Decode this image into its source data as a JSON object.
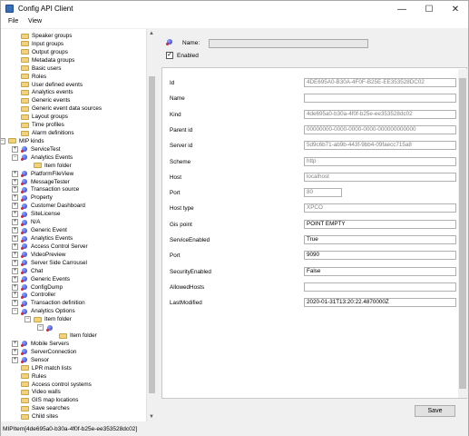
{
  "window": {
    "title": "Config API Client",
    "minimize": "—",
    "maximize": "☐",
    "close": "✕"
  },
  "menu": {
    "file": "File",
    "view": "View"
  },
  "tree": [
    {
      "label": "Speaker groups",
      "icon": "folder"
    },
    {
      "label": "Input groups",
      "icon": "folder"
    },
    {
      "label": "Output groups",
      "icon": "folder"
    },
    {
      "label": "Metadata groups",
      "icon": "folder"
    },
    {
      "label": "Basic users",
      "icon": "folder"
    },
    {
      "label": "Roles",
      "icon": "folder"
    },
    {
      "label": "User defined events",
      "icon": "folder"
    },
    {
      "label": "Analytics events",
      "icon": "folder"
    },
    {
      "label": "Generic events",
      "icon": "folder"
    },
    {
      "label": "Generic event data sources",
      "icon": "folder"
    },
    {
      "label": "Layout groups",
      "icon": "folder"
    },
    {
      "label": "Time profiles",
      "icon": "folder"
    },
    {
      "label": "Alarm definitions",
      "icon": "folder"
    },
    {
      "label": "MIP kinds",
      "icon": "folder",
      "expander": "−"
    },
    {
      "label": "ServiceTest",
      "icon": "pin",
      "expander": "+"
    },
    {
      "label": "Analytics Events",
      "icon": "pin",
      "expander": "−"
    },
    {
      "label": "Item folder",
      "icon": "folder"
    },
    {
      "label": "PlatformFileView",
      "icon": "pin",
      "expander": "+"
    },
    {
      "label": "MessageTester",
      "icon": "pin",
      "expander": "+"
    },
    {
      "label": "Transaction source",
      "icon": "pin",
      "expander": "+"
    },
    {
      "label": "Property",
      "icon": "pin",
      "expander": "+"
    },
    {
      "label": "Customer Dashboard",
      "icon": "pin",
      "expander": "+"
    },
    {
      "label": "SiteLicense",
      "icon": "pin",
      "expander": "+"
    },
    {
      "label": "N/A",
      "icon": "pin",
      "expander": "+"
    },
    {
      "label": "Generic Event",
      "icon": "pin",
      "expander": "+"
    },
    {
      "label": "Analytics Events",
      "icon": "pin",
      "expander": "+"
    },
    {
      "label": "Access Control Server",
      "icon": "pin",
      "expander": "+"
    },
    {
      "label": "VideoPreview",
      "icon": "pin",
      "expander": "+"
    },
    {
      "label": "Server Side Carrousel",
      "icon": "pin",
      "expander": "+"
    },
    {
      "label": "Chat",
      "icon": "pin",
      "expander": "+"
    },
    {
      "label": "Generic Events",
      "icon": "pin",
      "expander": "+"
    },
    {
      "label": "ConfigDump",
      "icon": "pin",
      "expander": "+"
    },
    {
      "label": "Controller",
      "icon": "pin",
      "expander": "+"
    },
    {
      "label": "Transaction definition",
      "icon": "pin",
      "expander": "+"
    },
    {
      "label": "Analytics Options",
      "icon": "pin",
      "expander": "−"
    },
    {
      "label": "Item folder",
      "icon": "folder",
      "expander": "−"
    },
    {
      "label": "",
      "icon": "pin",
      "expander": "−"
    },
    {
      "label": "Item folder",
      "icon": "folder"
    },
    {
      "label": "Mobile Servers",
      "icon": "pin",
      "expander": "+"
    },
    {
      "label": "ServerConnection",
      "icon": "pin",
      "expander": "+"
    },
    {
      "label": "Sensor",
      "icon": "pin",
      "expander": "+"
    },
    {
      "label": "LPR match lists",
      "icon": "folder"
    },
    {
      "label": "Rules",
      "icon": "folder"
    },
    {
      "label": "Access control systems",
      "icon": "folder"
    },
    {
      "label": "Video walls",
      "icon": "folder"
    },
    {
      "label": "GIS map locations",
      "icon": "folder"
    },
    {
      "label": "Save searches",
      "icon": "folder"
    },
    {
      "label": "Child sites",
      "icon": "folder"
    }
  ],
  "detail": {
    "name_label": "Name:",
    "name_value": "",
    "enabled_label": "Enabled",
    "enabled_checked": true,
    "properties": [
      {
        "label": "Id",
        "value": "4DE695A0-B30A-4F0F-B25E-EE353528DC02",
        "readonly": true
      },
      {
        "label": "Name",
        "value": "",
        "readonly": false
      },
      {
        "label": "Kind",
        "value": "4de695a0-b30a-4f0f-b25e-ee353528dc02",
        "readonly": true
      },
      {
        "label": "Parent id",
        "value": "00000000-0000-0000-0000-000000000000",
        "readonly": true
      },
      {
        "label": "Server id",
        "value": "5d9c6b71-ab9b-443f-9bb4-09faecc715a8",
        "readonly": true
      },
      {
        "label": "Scheme",
        "value": "http",
        "readonly": true
      },
      {
        "label": "Host",
        "value": "localhost",
        "readonly": true
      },
      {
        "label": "Port",
        "value": "80",
        "readonly": true
      },
      {
        "label": "Host type",
        "value": "XPCO",
        "readonly": true
      },
      {
        "label": "Gis point",
        "value": "POINT EMPTY",
        "readonly": false
      },
      {
        "label": "ServiceEnabled",
        "value": "True",
        "readonly": false
      },
      {
        "label": "Port",
        "value": "9090",
        "readonly": false
      },
      {
        "label": "SecurityEnabled",
        "value": "False",
        "readonly": false
      },
      {
        "label": "AllowedHosts",
        "value": "",
        "readonly": false
      },
      {
        "label": "LastModified",
        "value": "2020-01-31T13:20:22.4870000Z",
        "readonly": false
      }
    ],
    "save_label": "Save"
  },
  "status": {
    "text": "MIPItem[4de695a0-b30a-4f0f-b25e-ee353528dc02]"
  }
}
